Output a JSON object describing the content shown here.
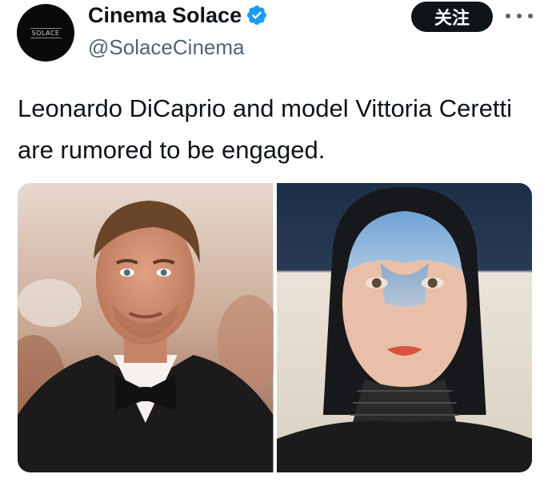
{
  "tweet": {
    "author": {
      "display_name": "Cinema Solace",
      "handle": "@SolaceCinema",
      "avatar_text": "SOLACE",
      "verified_icon": "verified-badge-icon",
      "verified_color": "#1d9bf0"
    },
    "follow_label": "关注",
    "more_icon": "more-horizontal-icon",
    "text": "Leonardo DiCaprio and model Vittoria Ceretti are rumored to be engaged.",
    "media": [
      {
        "icon": "photo-man-in-tuxedo"
      },
      {
        "icon": "photo-woman-portrait"
      }
    ]
  },
  "colors": {
    "text": "#0f1419",
    "secondary": "#536471",
    "follow_bg": "#0f1419",
    "follow_fg": "#ffffff"
  }
}
